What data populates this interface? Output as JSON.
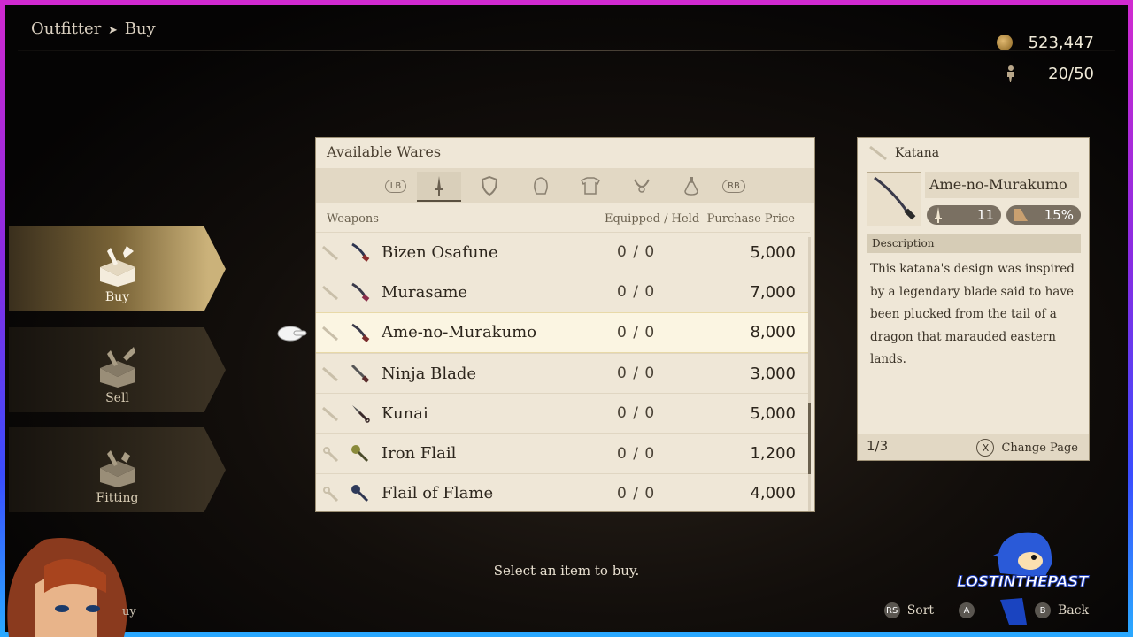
{
  "breadcrumb": {
    "section": "Outfitter",
    "separator": "➤",
    "page": "Buy"
  },
  "currency": {
    "money": "523,447",
    "party": "20/50"
  },
  "menu": [
    {
      "label": "Buy",
      "active": true
    },
    {
      "label": "Sell",
      "active": false
    },
    {
      "label": "Fitting",
      "active": false
    }
  ],
  "wares": {
    "title": "Available Wares",
    "tab_lb": "LB",
    "tab_rb": "RB",
    "category": "Weapons",
    "col_equipped": "Equipped / Held",
    "col_price": "Purchase Price",
    "items": [
      {
        "name": "Bizen Osafune",
        "held": "0 / 0",
        "price": "5,000"
      },
      {
        "name": "Murasame",
        "held": "0 / 0",
        "price": "7,000"
      },
      {
        "name": "Ame-no-Murakumo",
        "held": "0 / 0",
        "price": "8,000"
      },
      {
        "name": "Ninja Blade",
        "held": "0 / 0",
        "price": "3,000"
      },
      {
        "name": "Kunai",
        "held": "0 / 0",
        "price": "5,000"
      },
      {
        "name": "Iron Flail",
        "held": "0 / 0",
        "price": "1,200"
      },
      {
        "name": "Flail of Flame",
        "held": "0 / 0",
        "price": "4,000"
      }
    ]
  },
  "detail": {
    "category": "Katana",
    "name": "Ame-no-Murakumo",
    "stat_attack": "11",
    "stat_crit": "15%",
    "desc_header": "Description",
    "description": "This katana's design was inspired by a legendary blade said to have been plucked from the tail of a dragon that marauded eastern lands.",
    "page": "1/3",
    "change_btn": "X",
    "change_label": "Change Page"
  },
  "hint": "Select an item to buy.",
  "partial_label": "uy",
  "bottom": {
    "sort_btn": "RS",
    "sort_label": "Sort",
    "confirm_btn": "A",
    "back_btn": "B",
    "back_label": "Back"
  },
  "logo_text": "LOSTINTHEPAST"
}
